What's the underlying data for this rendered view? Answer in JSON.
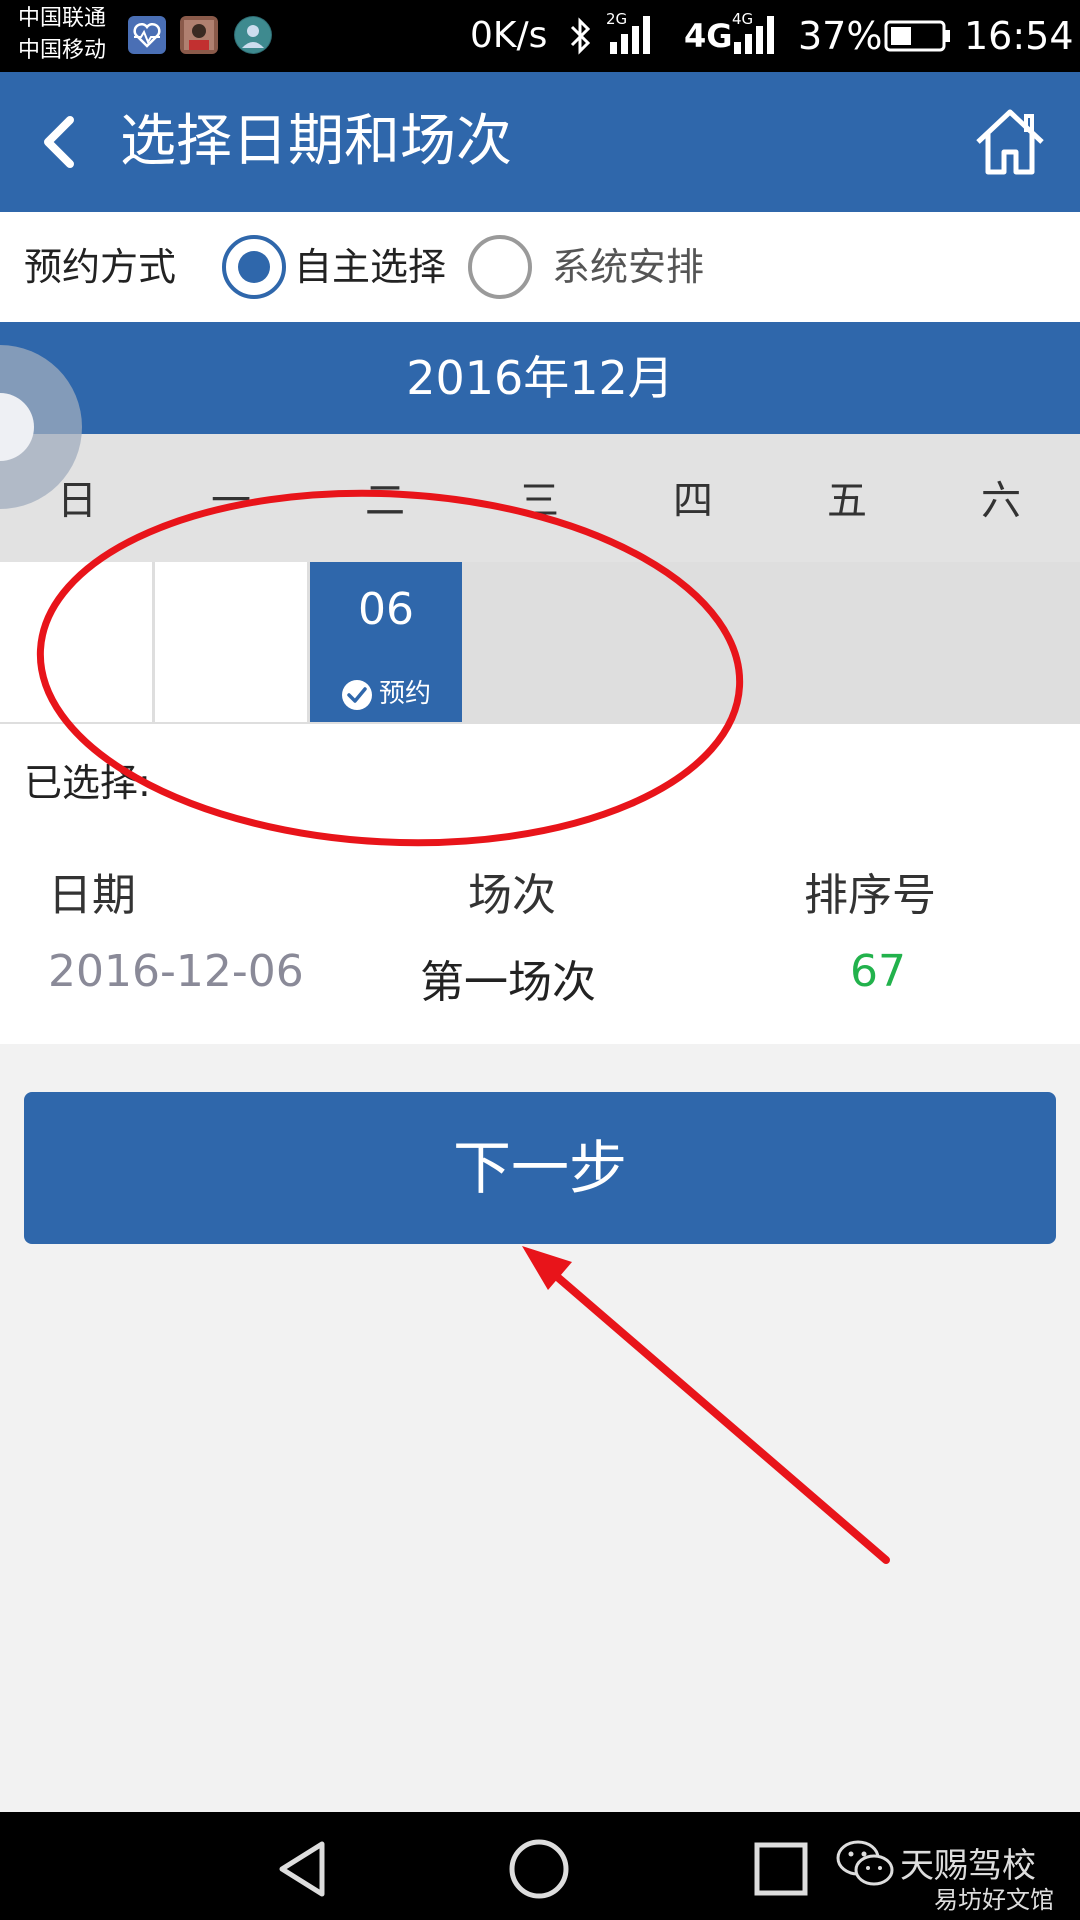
{
  "status_bar": {
    "carrier_1": "中国联通",
    "carrier_2": "中国移动",
    "net_speed": "0K/s",
    "sig_2g": "2G",
    "sig_4g_a": "4G",
    "sig_4g_b": "4G",
    "battery": "37%",
    "time": "16:54"
  },
  "header": {
    "title": "选择日期和场次"
  },
  "booking_method": {
    "label": "预约方式",
    "options": [
      {
        "label": "自主选择",
        "selected": true
      },
      {
        "label": "系统安排",
        "selected": false
      }
    ]
  },
  "calendar": {
    "month": "2016年12月",
    "weekdays": [
      "日",
      "一",
      "二",
      "三",
      "四",
      "五",
      "六"
    ],
    "days": [
      {
        "num": "",
        "status": ""
      },
      {
        "num": "",
        "status": ""
      },
      {
        "num": "06",
        "status": "预约"
      }
    ]
  },
  "selection": {
    "label": "已选择:",
    "columns": [
      "日期",
      "场次",
      "排序号"
    ],
    "row": {
      "date": "2016-12-06",
      "session": "第一场次",
      "order": "67"
    }
  },
  "next_button": {
    "label": "下一步"
  },
  "watermark": {
    "main": "天赐驾校",
    "sub": "易坊好文馆"
  },
  "colors": {
    "primary": "#2f67ab",
    "annotation": "#e8141a",
    "order_value": "#22b24c"
  }
}
